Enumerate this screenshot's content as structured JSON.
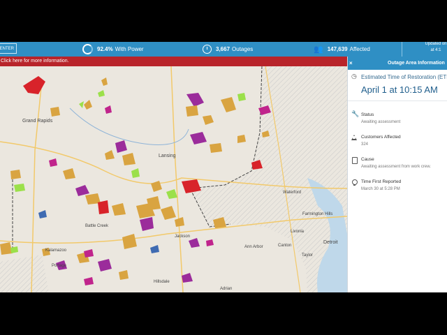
{
  "topbar": {
    "center_label": "CENTER",
    "with_power_pct": "92.4%",
    "with_power_label": "With Power",
    "outages_count": "3,667",
    "outages_label": "Outages",
    "affected_count": "147,639",
    "affected_label": "Affected",
    "updated_line1": "Updated on",
    "updated_line2": "at 4:1",
    "icons": [
      "progress-ring-icon",
      "clock-icon",
      "people-icon"
    ]
  },
  "banner": {
    "text": "Click here for more information."
  },
  "map": {
    "city_labels": [
      "Grand Rapids",
      "Lansing",
      "Battle Creek",
      "Kalamazoo",
      "Jackson",
      "Ann Arbor",
      "Detroit",
      "Canton",
      "Livonia",
      "Portage",
      "Farmington Hills",
      "Taylor",
      "Hillsdale",
      "Adrian",
      "Waterford"
    ],
    "outage_colors": {
      "red": "#d8232a",
      "orange": "#d9a441",
      "green": "#9be04a",
      "purple": "#9b2c9b",
      "magenta": "#c0248c",
      "blue": "#3f6bb2"
    }
  },
  "panel": {
    "title": "Outage Area Information",
    "close_icon": "close-icon",
    "etr_label": "Estimated Time of Restoration (ETR",
    "etr_value": "April 1 at 10:15 AM",
    "status_label": "Status",
    "status_value": "Awaiting assessment",
    "customers_label": "Customers Affected",
    "customers_value": "324",
    "cause_label": "Cause",
    "cause_value": "Awaiting assessment from work crew.",
    "first_reported_label": "Time First Reported",
    "first_reported_value": "March 30 at 5:28 PM"
  }
}
